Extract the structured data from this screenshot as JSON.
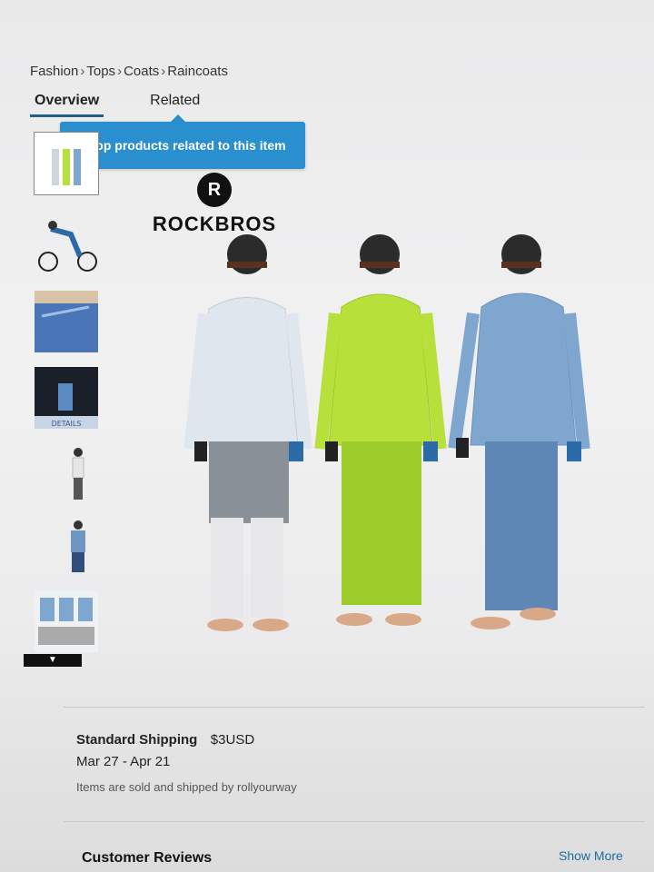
{
  "breadcrumb": [
    "Fashion",
    "Tops",
    "Coats",
    "Raincoats"
  ],
  "tabs": [
    "Overview",
    "Related"
  ],
  "tooltip": "Shop products related to this item",
  "logo": {
    "badge": "R",
    "text": "ROCKBROS"
  },
  "thumb_caption": "DETAILS",
  "shipping": {
    "title": "Standard Shipping",
    "price": "$3USD",
    "dates": "Mar 27 - Apr 21",
    "note": "Items are sold and shipped by rollyourway"
  },
  "reviews": {
    "title": "Customer Reviews",
    "show_more": "Show More"
  },
  "colors": {
    "accent": "#2a8fcf",
    "link": "#1d6fa5",
    "jacket_white": "#dfe6ee",
    "jacket_lime": "#b8e03a",
    "jacket_blue": "#7fa6cf"
  }
}
